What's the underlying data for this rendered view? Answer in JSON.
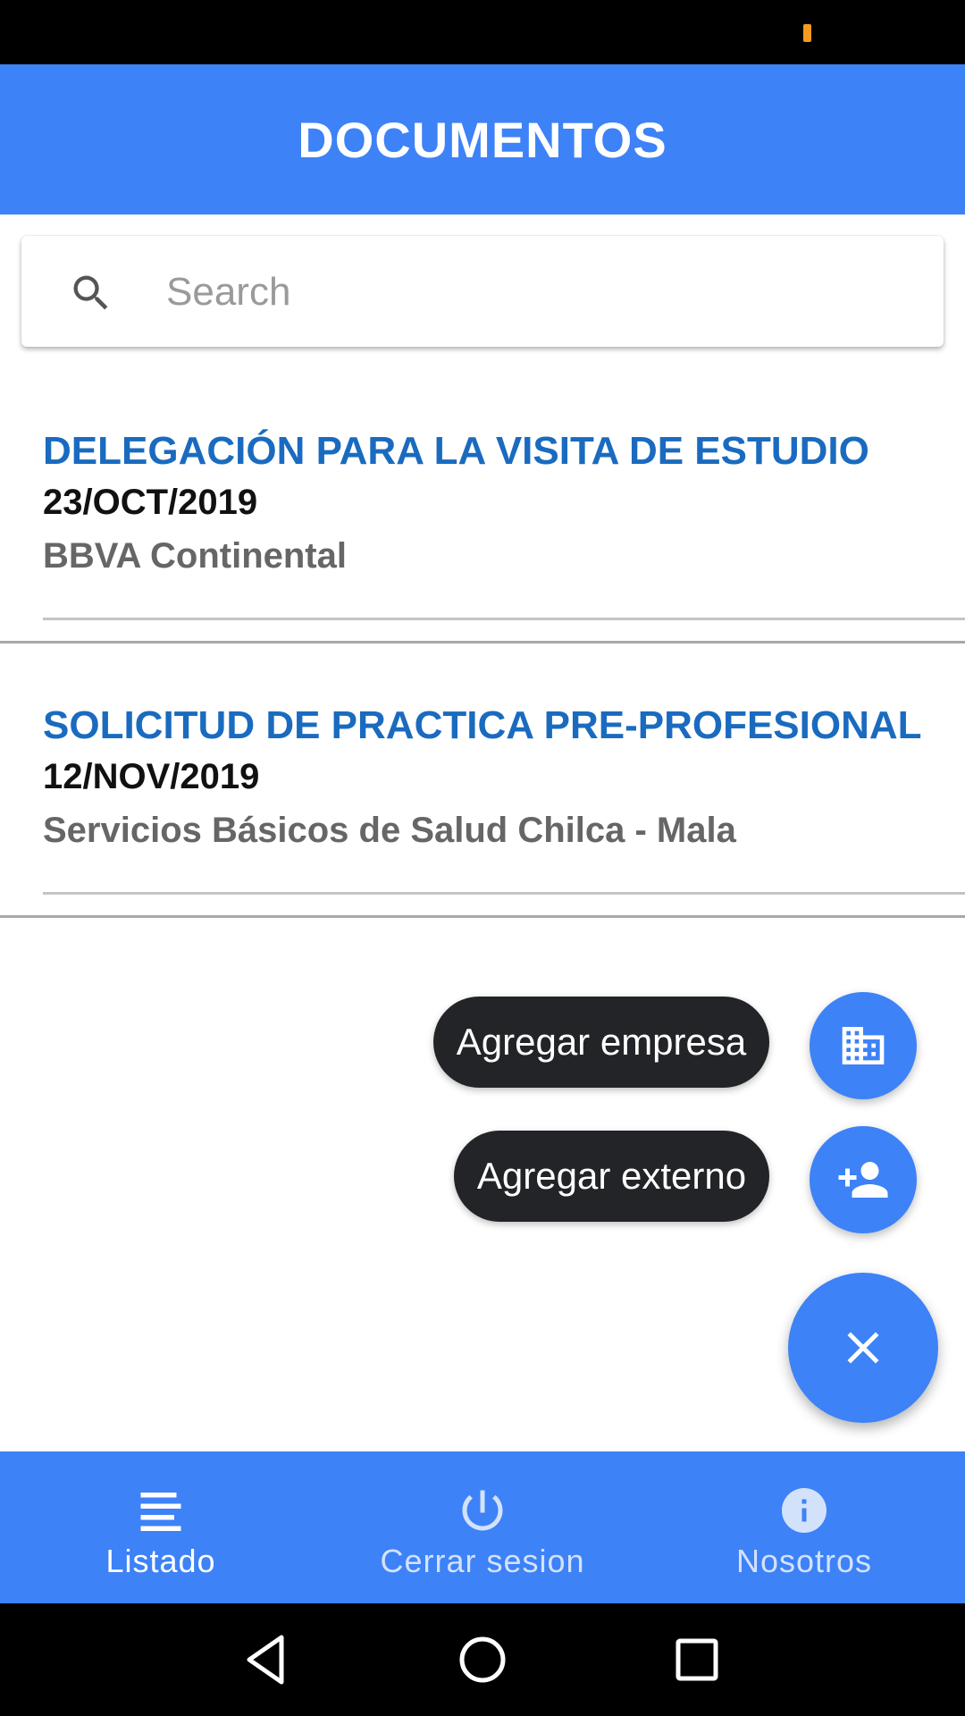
{
  "colors": {
    "primary": "#3d82f7",
    "title_blue": "#1a6bbf",
    "label_bg": "#232427",
    "battery": "#f59a1f",
    "nav_active": "#ffffff",
    "nav_inactive": "#d3e2fb"
  },
  "status_bar": {
    "indicator": "battery-low-indicator"
  },
  "header": {
    "title": "DOCUMENTOS"
  },
  "search": {
    "icon": "search-icon",
    "placeholder": "Search",
    "value": ""
  },
  "documents": [
    {
      "title": "DELEGACIÓN PARA LA VISITA DE ESTUDIO",
      "date": "23/OCT/2019",
      "company": "BBVA Continental"
    },
    {
      "title": "SOLICITUD DE PRACTICA PRE-PROFESIONAL",
      "date": "12/NOV/2019",
      "company": "Servicios Básicos de Salud Chilca - Mala"
    }
  ],
  "speed_dial": {
    "actions": [
      {
        "label": "Agregar empresa",
        "icon": "business-icon"
      },
      {
        "label": "Agregar externo",
        "icon": "person-add-icon"
      }
    ],
    "main_icon": "close-icon"
  },
  "bottom_nav": {
    "items": [
      {
        "label": "Listado",
        "icon": "list-icon",
        "active": true
      },
      {
        "label": "Cerrar sesion",
        "icon": "power-icon",
        "active": false
      },
      {
        "label": "Nosotros",
        "icon": "info-icon",
        "active": false
      }
    ]
  },
  "system_nav": {
    "buttons": [
      "back-icon",
      "home-icon",
      "recents-icon"
    ]
  }
}
